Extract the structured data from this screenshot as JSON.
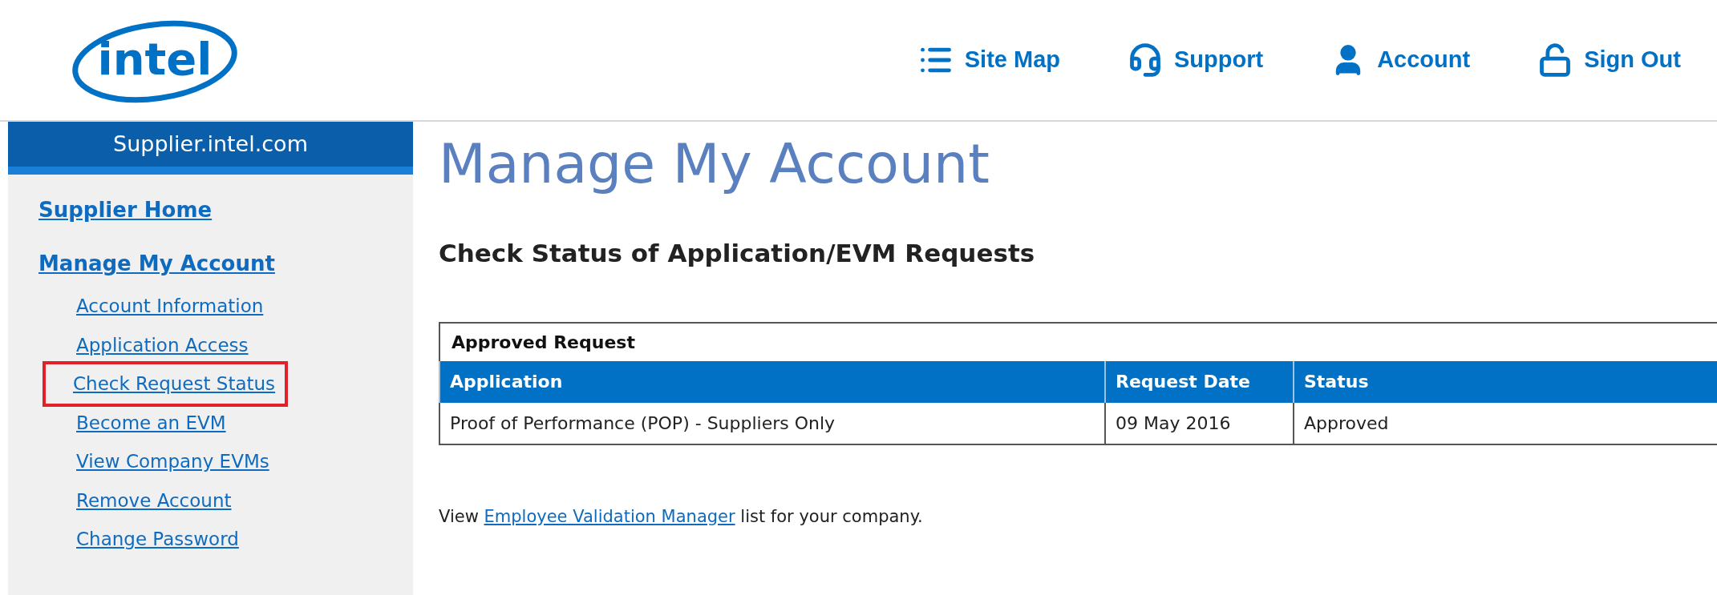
{
  "logo": {
    "text": "intel"
  },
  "nav": [
    {
      "label": "Site Map",
      "kind": "list"
    },
    {
      "label": "Support",
      "kind": "headset"
    },
    {
      "label": "Account",
      "kind": "user"
    },
    {
      "label": "Sign Out",
      "kind": "unlock"
    }
  ],
  "sidebar": {
    "title": "Supplier.intel.com",
    "items": [
      {
        "label": "Supplier Home",
        "highlighted": false
      },
      {
        "label": "Manage My Account",
        "highlighted": false,
        "children": [
          {
            "label": "Account Information",
            "highlighted": false
          },
          {
            "label": "Application Access",
            "highlighted": false
          },
          {
            "label": "Check Request Status",
            "highlighted": true
          },
          {
            "label": "Become an EVM",
            "highlighted": false
          },
          {
            "label": "View Company EVMs",
            "highlighted": false
          },
          {
            "label": "Remove Account",
            "highlighted": false
          },
          {
            "label": "Change Password",
            "highlighted": false
          }
        ]
      }
    ]
  },
  "page_title": "Manage My Account",
  "section_title": "Check Status of Application/EVM Requests",
  "table": {
    "caption": "Approved Request",
    "columns": [
      "Application",
      "Request Date",
      "Status"
    ],
    "rows": [
      [
        "Proof of Performance (POP) - Suppliers Only",
        "09 May 2016",
        "Approved"
      ]
    ]
  },
  "footer_note": {
    "before": "View",
    "link": "Employee Validation Manager",
    "after": "list for your company."
  }
}
